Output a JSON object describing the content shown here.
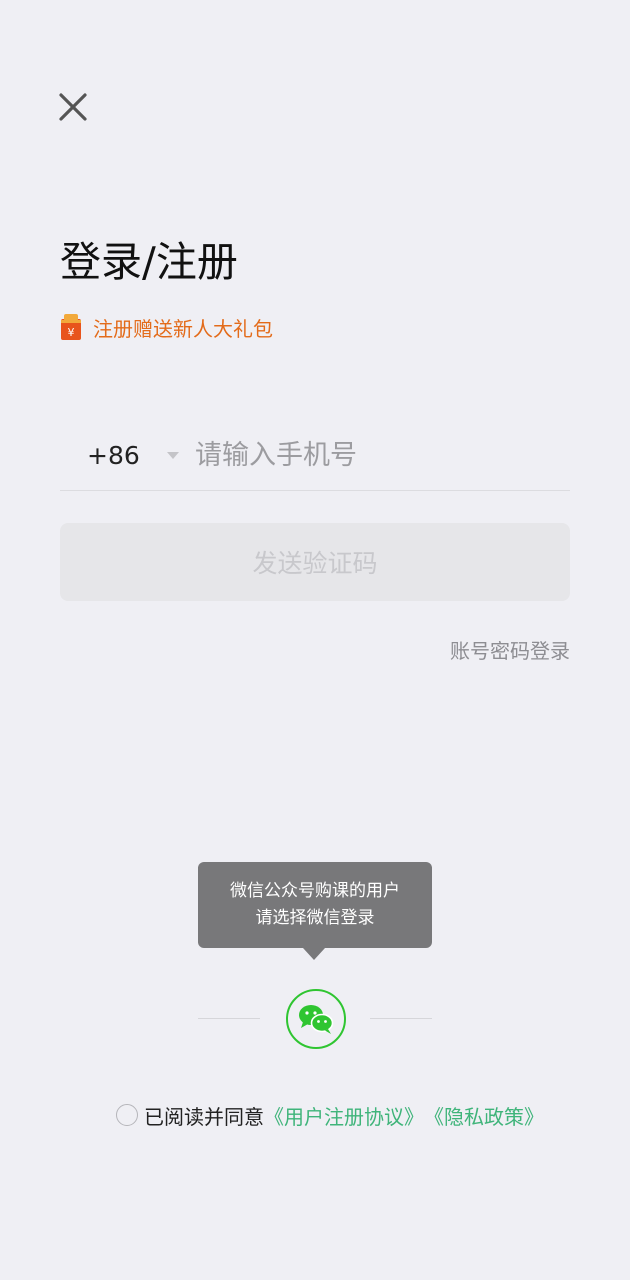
{
  "header": {
    "close_icon": "close-icon",
    "title": "登录/注册"
  },
  "promo": {
    "icon": "gift-bag-icon",
    "text": "注册赠送新人大礼包",
    "color": "#e36b1a"
  },
  "phone": {
    "country_code": "+86",
    "placeholder": "请输入手机号",
    "value": ""
  },
  "actions": {
    "send_code_label": "发送验证码",
    "password_login_label": "账号密码登录"
  },
  "wechat": {
    "tooltip_line1": "微信公众号购课的用户",
    "tooltip_line2": "请选择微信登录",
    "icon": "wechat-icon",
    "color": "#2fc531"
  },
  "agreement": {
    "prefix": "已阅读并同意",
    "user_agreement": "《用户注册协议》",
    "privacy_policy": "《隐私政策》",
    "checked": false,
    "link_color": "#3fb47a"
  }
}
